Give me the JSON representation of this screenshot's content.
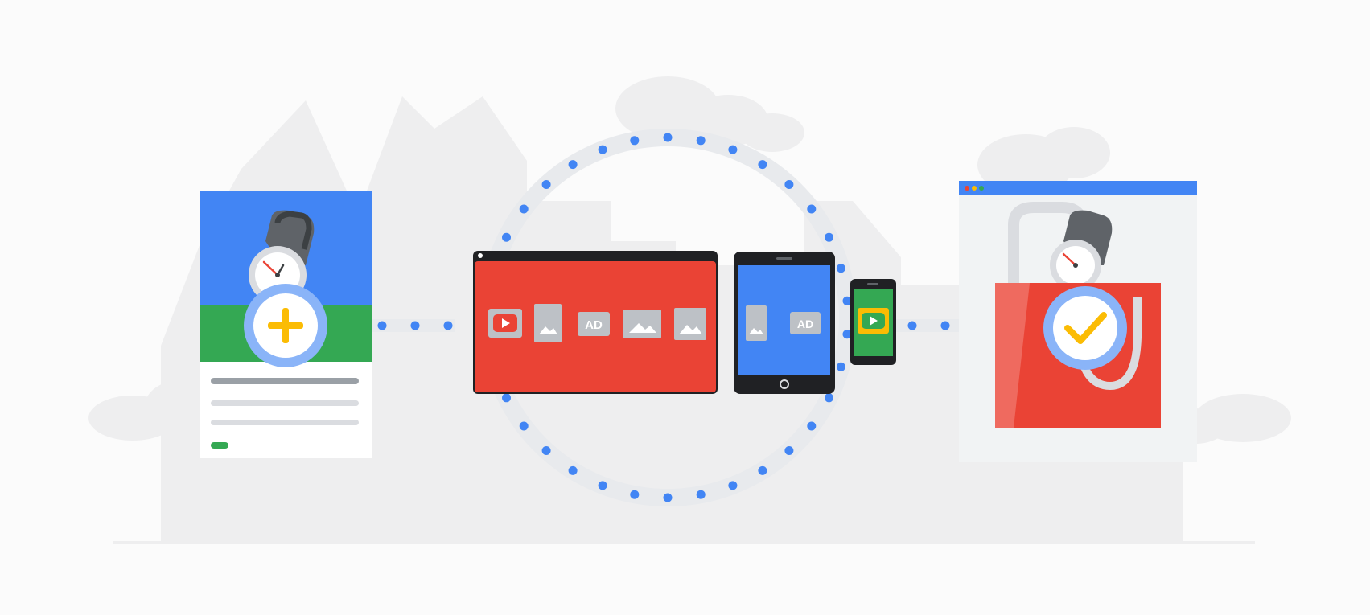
{
  "scene": {
    "description_free": true,
    "colors": {
      "background": "#fbfbfb",
      "backdrop": "#eeeeef",
      "backdrop_dark": "#e3e3e4",
      "blue": "#4285f4",
      "red": "#ea4335",
      "green": "#34a853",
      "yellow": "#fbbc04",
      "dark": "#202124",
      "gray": "#9aa0a6",
      "ring_track": "#e8eaed"
    },
    "icons": {
      "product_card_badge": "plus-icon",
      "shopping_bag_badge": "checkmark-icon",
      "desktop_ad_tiles": [
        "video-play-icon",
        "image-portrait-icon",
        "ad-badge-icon",
        "image-landscape-icon",
        "image-landscape-icon"
      ],
      "tablet_ad_tiles": [
        "image-portrait-icon",
        "ad-badge-icon"
      ],
      "phone_ad_tile": "video-play-icon"
    }
  },
  "labels": {
    "ad_badge": "AD"
  }
}
